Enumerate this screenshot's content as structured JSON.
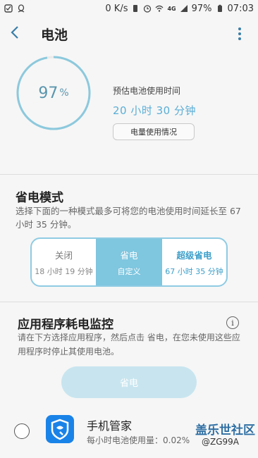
{
  "status_bar": {
    "network_speed": "0 K/s",
    "signal_type": "4G",
    "battery_percent": "97%",
    "time": "07:03"
  },
  "header": {
    "title": "电池"
  },
  "battery": {
    "level_percent": 97,
    "level_number": "97",
    "level_unit": "%",
    "estimate_label": "预估电池使用时间",
    "estimate_value": "20 小时 30 分钟",
    "usage_button": "电量使用情况"
  },
  "power_mode": {
    "title": "省电模式",
    "description": "选择下面的一种模式最多可将您的电池使用时间延长至 67 小时 35 分钟。",
    "options": [
      {
        "label": "关闭",
        "sub": "18 小时 19 分钟"
      },
      {
        "label": "省电",
        "sub": "自定义"
      },
      {
        "label": "超级省电",
        "sub": "67 小时 35 分钟"
      }
    ],
    "selected": "省电"
  },
  "app_monitor": {
    "title": "应用程序耗电监控",
    "info_icon": "i",
    "description": "请在下方选择应用程序，然后点击 省电，在您未使用这些应用程序时停止其使用电池。",
    "save_button": "省电",
    "apps": [
      {
        "name": "手机管家",
        "usage": "每小时电池使用量：0.02%"
      }
    ]
  },
  "watermark": {
    "text": "盖乐世社区",
    "handle": "@ZG99A"
  },
  "colors": {
    "accent": "#7fc6df",
    "ring": "#8cc9dd",
    "link": "#3a7ea6"
  }
}
